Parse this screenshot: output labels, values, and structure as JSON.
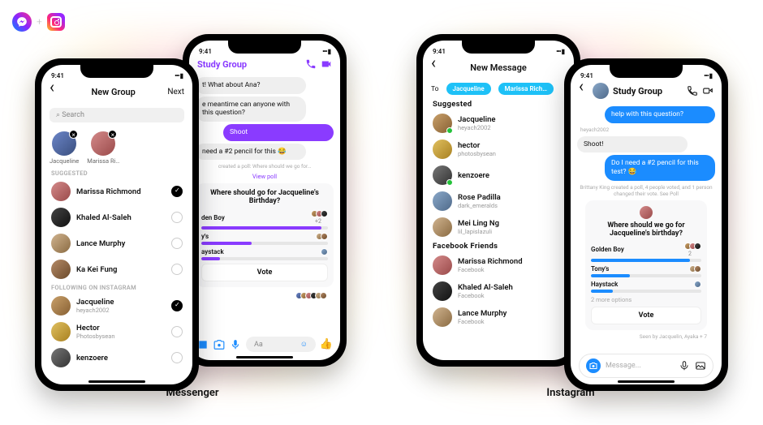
{
  "clock": "9:41",
  "signal_glyph": "••• ▮",
  "captions": {
    "messenger": "Messenger",
    "instagram": "Instagram"
  },
  "messenger_new_group": {
    "title": "New Group",
    "next": "Next",
    "search_ph": "Search",
    "selected_chips": [
      {
        "name": "Jacqueline"
      },
      {
        "name": "Marissa Ri…"
      }
    ],
    "suggested_hdr": "Suggested",
    "suggested": [
      {
        "name": "Marissa Richmond",
        "picked": true,
        "av": "av-c"
      },
      {
        "name": "Khaled Al-Saleh",
        "picked": false,
        "av": "av-d"
      },
      {
        "name": "Lance Murphy",
        "picked": false,
        "av": "av-e"
      },
      {
        "name": "Ka Kei Fung",
        "picked": false,
        "av": "av-f"
      }
    ],
    "following_hdr": "Following on Instagram",
    "following": [
      {
        "name": "Jacqueline",
        "sub": "heyach2002",
        "picked": true,
        "av": "av-b"
      },
      {
        "name": "Hector",
        "sub": "Photosbysean",
        "picked": false,
        "av": "av-h"
      },
      {
        "name": "kenzoere",
        "sub": "",
        "picked": false,
        "av": "av-i"
      }
    ]
  },
  "messenger_chat": {
    "title": "Study Group",
    "msg1": "t! What about Ana?",
    "msg2": "e meantime can anyone with this question?",
    "msg3": "Shoot",
    "msg4": "need a #2 pencil for this 😂",
    "poll_sys": "created a poll: Where should we go for…",
    "view_poll": "View poll",
    "poll": {
      "question": "Where should go for Jacqueline's Birthday?",
      "options": [
        {
          "label": "den Boy",
          "votes": "+2",
          "pct": 95,
          "avs": 3
        },
        {
          "label": "y's",
          "votes": "",
          "pct": 40,
          "avs": 2
        },
        {
          "label": "aystack",
          "votes": "",
          "pct": 15,
          "avs": 1
        }
      ],
      "vote_btn": "Vote"
    },
    "composer_ph": "Aa"
  },
  "instagram_new_msg": {
    "title": "New Message",
    "to": "To",
    "pills": [
      "Jacqueline",
      "Marissa Rich…"
    ],
    "suggested_hdr": "Suggested",
    "suggested": [
      {
        "name": "Jacqueline",
        "sub": "heyach2002",
        "av": "av-b",
        "online": true
      },
      {
        "name": "hector",
        "sub": "photosbysean",
        "av": "av-h",
        "online": false
      },
      {
        "name": "kenzoere",
        "sub": "",
        "av": "av-i",
        "online": true
      },
      {
        "name": "Rose Padilla",
        "sub": "dark_emeralds",
        "av": "av-g",
        "online": false
      },
      {
        "name": "Mei Ling Ng",
        "sub": "lil_lapislazuli",
        "av": "av-e",
        "online": false
      }
    ],
    "fbf_hdr": "Facebook Friends",
    "fbfriends": [
      {
        "name": "Marissa Richmond",
        "sub": "Facebook",
        "av": "av-c"
      },
      {
        "name": "Khaled Al-Saleh",
        "sub": "Facebook",
        "av": "av-d"
      },
      {
        "name": "Lance Murphy",
        "sub": "Facebook",
        "av": "av-e"
      }
    ]
  },
  "instagram_chat": {
    "title": "Study Group",
    "msg1": "help with this question?",
    "by": "heyach2002",
    "msg2": "Shoot!",
    "msg3": "Do I need a #2 pencil for this test? 😂",
    "poll_sys": "Brittany King created a poll, 4 people voted, and 1 person changed their vote. See Poll",
    "see_poll": "See Poll",
    "poll": {
      "question": "Where should we go for Jacqueline's birthday?",
      "options": [
        {
          "label": "Golden Boy",
          "votes": "2",
          "pct": 90,
          "avs": 3
        },
        {
          "label": "Tony's",
          "votes": "",
          "pct": 35,
          "avs": 2
        },
        {
          "label": "Haystack",
          "votes": "",
          "pct": 20,
          "avs": 1
        }
      ],
      "more": "2 more options",
      "vote_btn": "Vote"
    },
    "seen": "Seen by Jacquelin, Ayaka + 7",
    "composer_ph": "Message..."
  }
}
